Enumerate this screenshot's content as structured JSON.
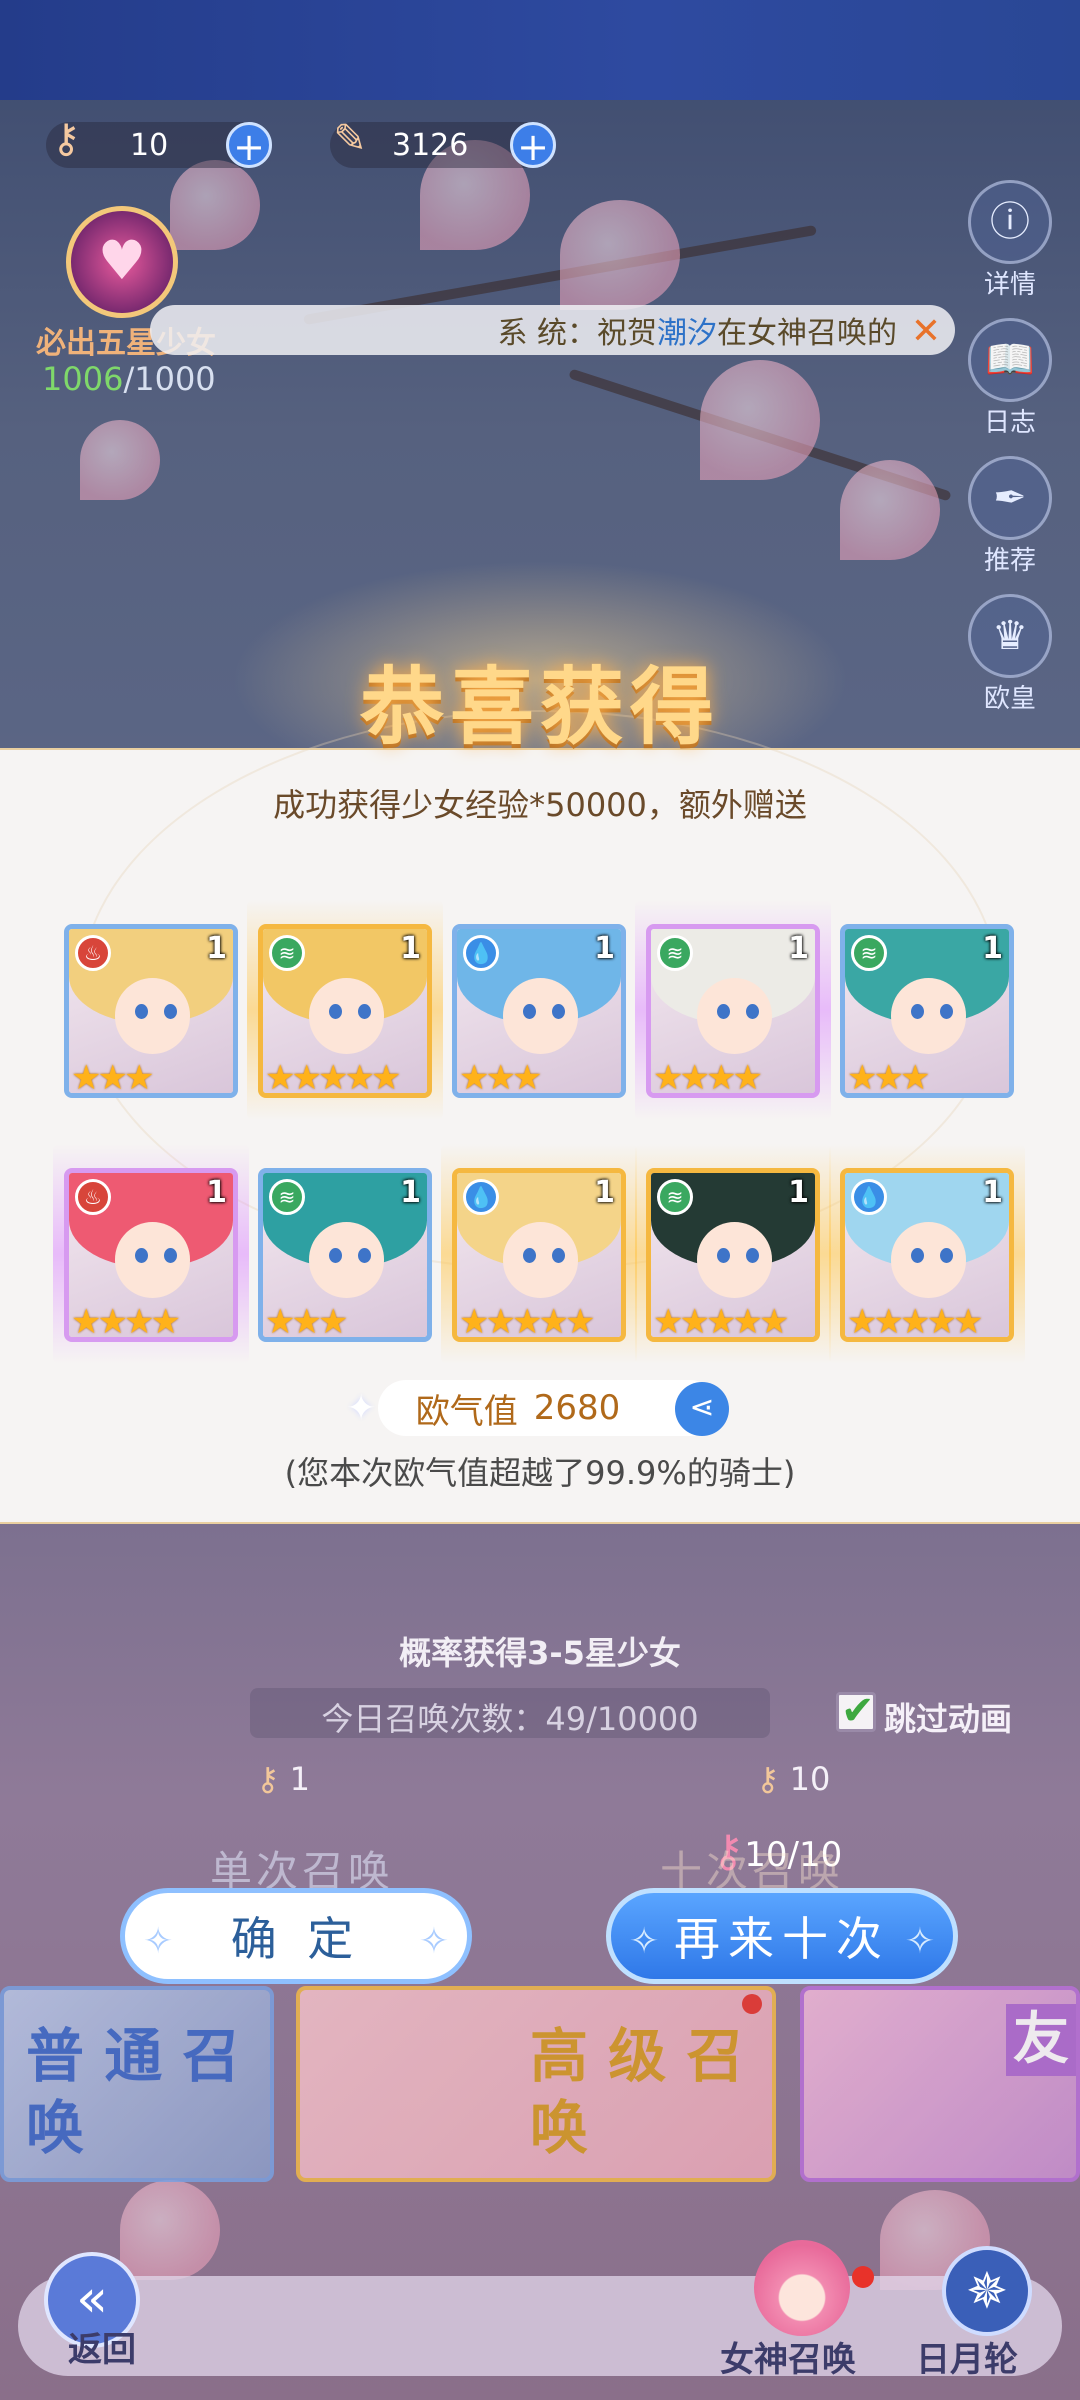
{
  "resources": [
    {
      "icon": "summon-key-icon",
      "value": "10"
    },
    {
      "icon": "feather-quill-icon",
      "value": "3126"
    }
  ],
  "guarantee": {
    "label": "必出五星少女",
    "current": "1006",
    "total": "/1000"
  },
  "ticker": {
    "prefix": "系  统：祝贺",
    "name": "潮汐",
    "suffix": "在女神召唤的"
  },
  "side_buttons": [
    {
      "label": "详情",
      "icon": "info-icon"
    },
    {
      "label": "日志",
      "icon": "book-icon"
    },
    {
      "label": "推荐",
      "icon": "quill-icon"
    },
    {
      "label": "欧皇",
      "icon": "crown-icon"
    }
  ],
  "result": {
    "title": "恭喜获得",
    "subtitle": "成功获得少女经验*50000，额外赠送",
    "luck_label": "欧气值",
    "luck_value": "2680",
    "luck_line": "(您本次欧气值超越了99.9%的骑士)"
  },
  "cards": [
    {
      "count": "1",
      "stars": 3,
      "element": "fire",
      "hair": "#f2cf7e",
      "glow": "none"
    },
    {
      "count": "1",
      "stars": 5,
      "element": "wind",
      "hair": "#f2c765",
      "glow": "gold"
    },
    {
      "count": "1",
      "stars": 3,
      "element": "water",
      "hair": "#6fb6e8",
      "glow": "none"
    },
    {
      "count": "1",
      "stars": 4,
      "element": "wind",
      "hair": "#ecebe6",
      "glow": "purple"
    },
    {
      "count": "1",
      "stars": 3,
      "element": "wind",
      "hair": "#3aa7a4",
      "glow": "none"
    },
    {
      "count": "1",
      "stars": 4,
      "element": "fire",
      "hair": "#ee5a72",
      "glow": "purple"
    },
    {
      "count": "1",
      "stars": 3,
      "element": "wind",
      "hair": "#2ea0a2",
      "glow": "none"
    },
    {
      "count": "1",
      "stars": 5,
      "element": "water",
      "hair": "#f4d489",
      "glow": "gold"
    },
    {
      "count": "1",
      "stars": 5,
      "element": "wind",
      "hair": "#243a34",
      "glow": "gold"
    },
    {
      "count": "1",
      "stars": 5,
      "element": "water",
      "hair": "#9fd6ef",
      "glow": "gold"
    }
  ],
  "background": {
    "prob_text": "概率获得3-5星少女",
    "daily_count": "今日召唤次数：49/10000",
    "skip_label": "跳过动画",
    "single_cost": "1",
    "ten_cost": "10",
    "ten_progress": "10/10",
    "single_label": "单次召唤",
    "ten_label": "十次召唤",
    "panel_normal": "普 通 召唤",
    "panel_advanced": "高 级 召唤",
    "panel_friend": "友"
  },
  "buttons": {
    "confirm": "确 定",
    "again": "再来十次"
  },
  "bottom_nav": {
    "back": "返回",
    "goddess": "女神召唤",
    "sunmoon": "日月轮"
  }
}
